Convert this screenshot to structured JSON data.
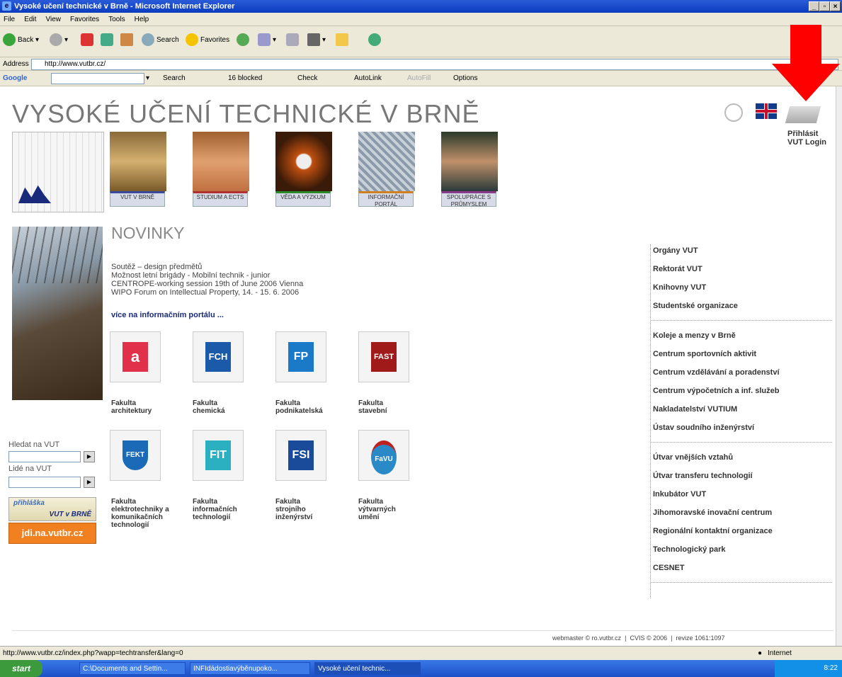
{
  "window": {
    "title": "Vysoké učení technické v Brně - Microsoft Internet Explorer"
  },
  "menu": [
    "File",
    "Edit",
    "View",
    "Favorites",
    "Tools",
    "Help"
  ],
  "toolbar": {
    "back": "Back",
    "search": "Search",
    "favorites": "Favorites"
  },
  "address": {
    "label": "Address",
    "url": "http://www.vutbr.cz/"
  },
  "googlebar": {
    "brand": "Google",
    "search": "Search",
    "blocked": "16 blocked",
    "check": "Check",
    "autolink": "AutoLink",
    "autofill": "AutoFill",
    "options": "Options"
  },
  "site": {
    "title": "VYSOKÉ UČENÍ TECHNICKÉ V BRNĚ",
    "login": [
      "Přihlásit",
      "VUT Login"
    ],
    "nav": [
      "VUT V BRNĚ",
      "STUDIUM A ECTS",
      "VĚDA A VÝZKUM",
      "INFORMAČNÍ PORTÁL",
      "SPOLUPRÁCE S PRŮMYSLEM"
    ],
    "news_heading": "NOVINKY",
    "news": [
      "Soutěž – design předmětů",
      "Možnost letní brigády - Mobilní technik - junior",
      "CENTROPE-working session 19th of June 2006 Vienna",
      "WIPO Forum on Intellectual Property, 14. - 15. 6. 2006"
    ],
    "more_link": "více na informačním portálu ...",
    "faculties": [
      {
        "name": [
          "Fakulta",
          "architektury"
        ],
        "icon": "a"
      },
      {
        "name": [
          "Fakulta",
          "chemická"
        ],
        "icon": "FCH"
      },
      {
        "name": [
          "Fakulta",
          "podnikatelská"
        ],
        "icon": "FP"
      },
      {
        "name": [
          "Fakulta",
          "stavební"
        ],
        "icon": "FAST"
      },
      {
        "name": [
          "Fakulta",
          "elektrotechniky a",
          "komunikačních",
          "technologií"
        ],
        "icon": "FEKT"
      },
      {
        "name": [
          "Fakulta",
          "informačních",
          "technologií"
        ],
        "icon": "FIT"
      },
      {
        "name": [
          "Fakulta",
          "strojního",
          "inženýrství"
        ],
        "icon": "FSI"
      },
      {
        "name": [
          "Fakulta",
          "výtvarných",
          "umění"
        ],
        "icon": "FaVU"
      }
    ],
    "search_vut_label": "Hledat na VUT",
    "people_label": "Lidé na VUT",
    "banner1": [
      "přihláška",
      "VUT v BRNĚ"
    ],
    "banner2": "jdi.na.vutbr.cz",
    "right_links_1": [
      "Orgány VUT",
      "Rektorát VUT",
      "Knihovny VUT",
      "Studentské organizace"
    ],
    "right_links_2": [
      "Koleje a menzy v Brně",
      "Centrum sportovních aktivit",
      "Centrum vzdělávání a poradenství",
      "Centrum výpočetních a inf. služeb",
      "Nakladatelství VUTIUM",
      "Ústav soudního inženýrství"
    ],
    "right_links_3": [
      "Útvar vnějších vztahů",
      "Útvar transferu technologií",
      "Inkubátor VUT",
      "Jihomoravské inovační centrum",
      "Regionální kontaktní organizace",
      "Technologický park",
      "CESNET"
    ],
    "footer": "webmaster © ro.vutbr.cz  |  CVIS © 2006  |  revize 1061:1097"
  },
  "status": {
    "url": "http://www.vutbr.cz/index.php?wapp=techtransfer&lang=0",
    "zone": "Internet"
  },
  "taskbar": {
    "start": "start",
    "tasks": [
      "C:\\Documents and Settin...",
      "INFIdádostiavýběnupoko...",
      "Vysoké učení technic..."
    ],
    "clock": "8:22"
  },
  "colors": {
    "title_blue": "#0a3cc0",
    "link": "#1a2a7a",
    "arrow": "#ff0000"
  }
}
